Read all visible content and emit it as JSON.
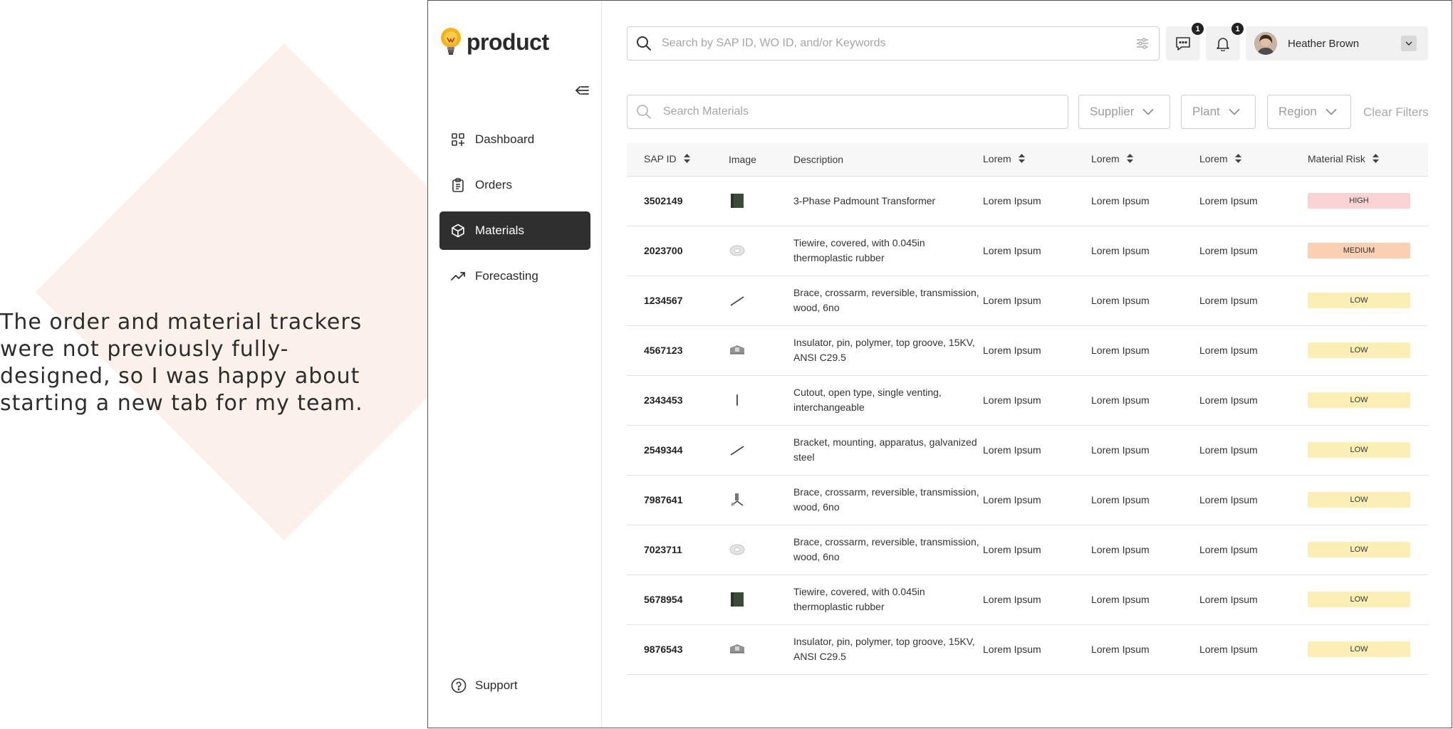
{
  "caption": "The order and material trackers were not previously fully-designed, so I was happy about starting a new tab for my team.",
  "colors": {
    "high": "#f9d3d4",
    "medium": "#f9d0b1",
    "low": "#fbefb5",
    "active_nav": "#2f2f2f"
  },
  "brand": {
    "name": "product",
    "icon": "lightbulb-icon"
  },
  "sidebar": {
    "items": [
      {
        "label": "Dashboard",
        "icon": "dashboard-icon",
        "active": false
      },
      {
        "label": "Orders",
        "icon": "clipboard-icon",
        "active": false
      },
      {
        "label": "Materials",
        "icon": "cube-icon",
        "active": true
      },
      {
        "label": "Forecasting",
        "icon": "trend-icon",
        "active": false
      }
    ],
    "support": "Support"
  },
  "header": {
    "search_placeholder": "Search by SAP ID, WO ID, and/or Keywords",
    "messages_count": "1",
    "notifications_count": "1",
    "user_name": "Heather Brown"
  },
  "filters": {
    "search_placeholder": "Search Materials",
    "supplier": "Supplier",
    "plant": "Plant",
    "region": "Region",
    "clear": "Clear Filters"
  },
  "table": {
    "columns": [
      "SAP ID",
      "Image",
      "Description",
      "Lorem",
      "Lorem",
      "Lorem",
      "Material Risk"
    ],
    "rows": [
      {
        "sap": "3502149",
        "image": "transformer",
        "desc": "3-Phase Padmount Transformer",
        "c1": "Lorem Ipsum",
        "c2": "Lorem Ipsum",
        "c3": "Lorem Ipsum",
        "risk": "HIGH",
        "level": "high"
      },
      {
        "sap": "2023700",
        "image": "wire-coil",
        "desc": "Tiewire, covered, with 0.045in thermoplastic rubber",
        "c1": "Lorem Ipsum",
        "c2": "Lorem Ipsum",
        "c3": "Lorem Ipsum",
        "risk": "MEDIUM",
        "level": "medium"
      },
      {
        "sap": "1234567",
        "image": "brace",
        "desc": "Brace, crossarm, reversible, transmission, wood, 6no",
        "c1": "Lorem Ipsum",
        "c2": "Lorem Ipsum",
        "c3": "Lorem Ipsum",
        "risk": "LOW",
        "level": "low"
      },
      {
        "sap": "4567123",
        "image": "insulator",
        "desc": "Insulator, pin, polymer, top groove, 15KV, ANSI C29.5",
        "c1": "Lorem Ipsum",
        "c2": "Lorem Ipsum",
        "c3": "Lorem Ipsum",
        "risk": "LOW",
        "level": "low"
      },
      {
        "sap": "2343453",
        "image": "cutout",
        "desc": "Cutout, open type, single venting, interchangeable",
        "c1": "Lorem Ipsum",
        "c2": "Lorem Ipsum",
        "c3": "Lorem Ipsum",
        "risk": "LOW",
        "level": "low"
      },
      {
        "sap": "2549344",
        "image": "brace",
        "desc": "Bracket, mounting, apparatus, galvanized steel",
        "c1": "Lorem Ipsum",
        "c2": "Lorem Ipsum",
        "c3": "Lorem Ipsum",
        "risk": "LOW",
        "level": "low"
      },
      {
        "sap": "7987641",
        "image": "hardware",
        "desc": "Brace, crossarm, reversible, transmission, wood, 6no",
        "c1": "Lorem Ipsum",
        "c2": "Lorem Ipsum",
        "c3": "Lorem Ipsum",
        "risk": "LOW",
        "level": "low"
      },
      {
        "sap": "7023711",
        "image": "wire-coil",
        "desc": "Brace, crossarm, reversible, transmission, wood, 6no",
        "c1": "Lorem Ipsum",
        "c2": "Lorem Ipsum",
        "c3": "Lorem Ipsum",
        "risk": "LOW",
        "level": "low"
      },
      {
        "sap": "5678954",
        "image": "transformer",
        "desc": "Tiewire, covered, with 0.045in thermoplastic rubber",
        "c1": "Lorem Ipsum",
        "c2": "Lorem Ipsum",
        "c3": "Lorem Ipsum",
        "risk": "LOW",
        "level": "low"
      },
      {
        "sap": "9876543",
        "image": "insulator",
        "desc": "Insulator, pin, polymer, top groove, 15KV, ANSI C29.5",
        "c1": "Lorem Ipsum",
        "c2": "Lorem Ipsum",
        "c3": "Lorem Ipsum",
        "risk": "LOW",
        "level": "low"
      }
    ]
  }
}
